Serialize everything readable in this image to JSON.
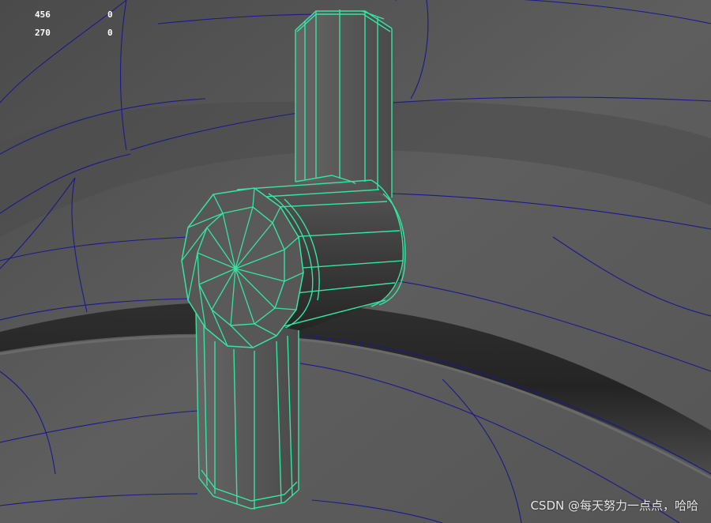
{
  "viewport": {
    "stats": [
      {
        "value": "456",
        "delta": "0"
      },
      {
        "value": "270",
        "delta": "0"
      }
    ]
  },
  "watermark": {
    "text": "CSDN @每天努力一点点，哈哈"
  },
  "colors": {
    "background": "#5a5a5a",
    "surface_wire": "#1a1a8c",
    "selected_wire": "#33e6a0",
    "hud_text": "#ffffff"
  }
}
